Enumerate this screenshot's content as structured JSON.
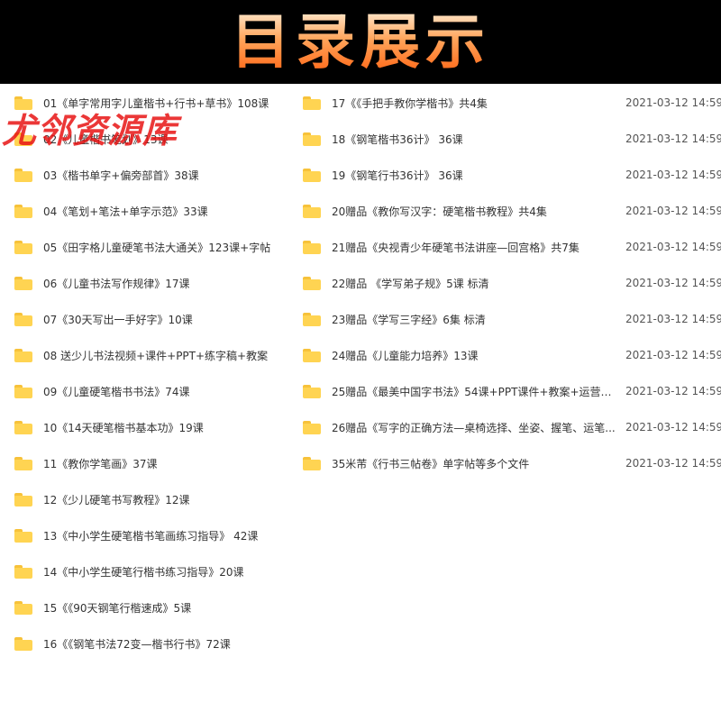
{
  "header": {
    "title": "目录展示"
  },
  "watermark": "尤邻资源库",
  "left_files": [
    {
      "name": "01《单字常用字儿童楷书+行书+草书》108课"
    },
    {
      "name": "02《儿童楷书笔划》13课"
    },
    {
      "name": "03《楷书单字+偏旁部首》38课"
    },
    {
      "name": "04《笔划+笔法+单字示范》33课"
    },
    {
      "name": "05《田字格儿童硬笔书法大通关》123课+字帖"
    },
    {
      "name": "06《儿童书法写作规律》17课"
    },
    {
      "name": "07《30天写出一手好字》10课"
    },
    {
      "name": "08 送少儿书法视频+课件+PPT+练字稿+教案"
    },
    {
      "name": "09《儿童硬笔楷书书法》74课"
    },
    {
      "name": "10《14天硬笔楷书基本功》19课"
    },
    {
      "name": "11《教你学笔画》37课"
    },
    {
      "name": "12《少儿硬笔书写教程》12课"
    },
    {
      "name": "13《中小学生硬笔楷书笔画练习指导》 42课"
    },
    {
      "name": "14《中小学生硬笔行楷书练习指导》20课"
    },
    {
      "name": "15《《90天钢笔行楷速成》5课"
    },
    {
      "name": "16《《钢笔书法72变—楷书行书》72课"
    }
  ],
  "right_files": [
    {
      "name": "17《《手把手教你学楷书》共4集",
      "date": "2021-03-12 14:59"
    },
    {
      "name": "18《钢笔楷书36计》 36课",
      "date": "2021-03-12 14:59"
    },
    {
      "name": "19《钢笔行书36计》 36课",
      "date": "2021-03-12 14:59"
    },
    {
      "name": "20赠品《教你写汉字：硬笔楷书教程》共4集",
      "date": "2021-03-12 14:59"
    },
    {
      "name": "21赠品《央视青少年硬笔书法讲座—回宫格》共7集",
      "date": "2021-03-12 14:59"
    },
    {
      "name": "22赠品 《学写弟子规》5课 标清",
      "date": "2021-03-12 14:59"
    },
    {
      "name": "23赠品《学写三字经》6集 标清",
      "date": "2021-03-12 14:59"
    },
    {
      "name": "24赠品《儿童能力培养》13课",
      "date": "2021-03-12 14:59"
    },
    {
      "name": "25赠品《最美中国字书法》54课+PPT课件+教案+运营资...",
      "date": "2021-03-12 14:59"
    },
    {
      "name": "26赠品《写字的正确方法—桌椅选择、坐姿、握笔、运笔...",
      "date": "2021-03-12 14:59"
    },
    {
      "name": "35米芾《行书三帖卷》单字帖等多个文件",
      "date": "2021-03-12 14:59"
    }
  ]
}
